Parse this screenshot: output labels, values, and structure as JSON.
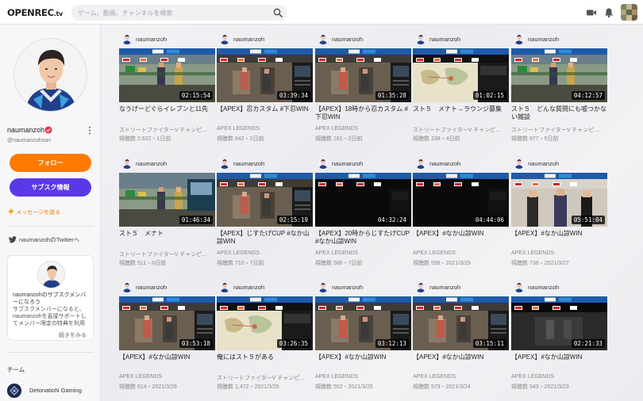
{
  "header": {
    "logo": "OPENREC",
    "logo_suffix": ".tv",
    "search_placeholder": "ゲーム、動画、チャンネルを検索"
  },
  "profile": {
    "name": "naumanzoh",
    "handle": "@naumanzohsan",
    "follow_label": "フォロー",
    "subscribe_label": "サブスク情報",
    "message_label": "メッセージを送る",
    "twitter_label": "naumanzohのTwitterへ",
    "sub_card": {
      "title": "naumanzohのサブスクメンバーになろう",
      "description": "サブスクメンバーになると、naumanzohを直接サポートしてメンバー限定の特典を利用で…",
      "more_label": "続きをみる"
    },
    "team_label": "チーム",
    "team_name": "DetonatioN Gaming"
  },
  "colors": {
    "follow": "#ff7a00",
    "subscribe": "#5a38e8",
    "verified": "#e6304a",
    "banner_blue": "#1e5aa8"
  },
  "videos": [
    {
      "user": "naumanzoh",
      "duration": "02:15:54",
      "title": "なうげーどぐらイレブンと11先",
      "game": "ストリートファイターV チャンピ…",
      "stats": "視聴数 2,622・1日前",
      "theme": "street"
    },
    {
      "user": "naumanzoh",
      "duration": "03:39:34",
      "title": "【APEX】忍カスタム #下忍WIN",
      "game": "APEX LEGENDS",
      "stats": "視聴数 642・2日前",
      "theme": "apex"
    },
    {
      "user": "naumanzoh",
      "duration": "01:35:28",
      "title": "【APEX】18時から忍カスタム #下忍WIN",
      "game": "APEX LEGENDS",
      "stats": "視聴数 161・2日前",
      "theme": "apex"
    },
    {
      "user": "naumanzoh",
      "duration": "01:02:15",
      "title": "スト５　メナト→ラウンジ募集",
      "game": "ストリートファイターV チャンピ…",
      "stats": "視聴数 238・4日前",
      "theme": "map"
    },
    {
      "user": "naumanzoh",
      "duration": "04:12:57",
      "title": "スト５　どんな質問にも嘘つかない雑談",
      "game": "ストリートファイターV チャンピ…",
      "stats": "視聴数 977・5日前",
      "theme": "street"
    },
    {
      "user": "naumanzoh",
      "duration": "01:46:34",
      "title": "スト５　メナト",
      "game": "ストリートファイターV チャンピ…",
      "stats": "視聴数 511・6日前",
      "theme": "street2"
    },
    {
      "user": "naumanzoh",
      "duration": "02:15:19",
      "title": "【APEX】じすたげCUP #なか山諒WIN",
      "game": "APEX LEGENDS",
      "stats": "視聴数 710・7日前",
      "theme": "apex"
    },
    {
      "user": "naumanzoh",
      "duration": "04:32:24",
      "title": "【APEX】20時からじすたげCUP #なか山諒WIN",
      "game": "APEX LEGENDS",
      "stats": "視聴数 586・7日前",
      "theme": "dark"
    },
    {
      "user": "naumanzoh",
      "duration": "04:44:06",
      "title": "【APEX】#なか山諒WIN",
      "game": "APEX LEGENDS",
      "stats": "視聴数 598・2021/3/29",
      "theme": "dark"
    },
    {
      "user": "naumanzoh",
      "duration": "05:51:04",
      "title": "【APEX】#なか山諒WIN",
      "game": "APEX LEGENDS",
      "stats": "視聴数 736・2021/3/27",
      "theme": "people"
    },
    {
      "user": "naumanzoh",
      "duration": "03:53:18",
      "title": "【APEX】#なか山諒WIN",
      "game": "APEX LEGENDS",
      "stats": "視聴数 614・2021/3/26",
      "theme": "apex"
    },
    {
      "user": "naumanzoh",
      "duration": "03:26:35",
      "title": "俺にはスト５がある",
      "game": "ストリートファイターV チャンピ…",
      "stats": "視聴数 1,472・2021/3/25",
      "theme": "map"
    },
    {
      "user": "naumanzoh",
      "duration": "03:12:13",
      "title": "【APEX】#なか山諒WIN",
      "game": "APEX LEGENDS",
      "stats": "視聴数 552・2021/3/25",
      "theme": "apex"
    },
    {
      "user": "naumanzoh",
      "duration": "03:15:11",
      "title": "【APEX】#なか山諒WIN",
      "game": "APEX LEGENDS",
      "stats": "視聴数 579・2021/3/24",
      "theme": "apex"
    },
    {
      "user": "naumanzoh",
      "duration": "02:21:33",
      "title": "【APEX】#なか山諒WIN",
      "game": "APEX LEGENDS",
      "stats": "視聴数 543・2021/3/23",
      "theme": "dark2"
    }
  ]
}
